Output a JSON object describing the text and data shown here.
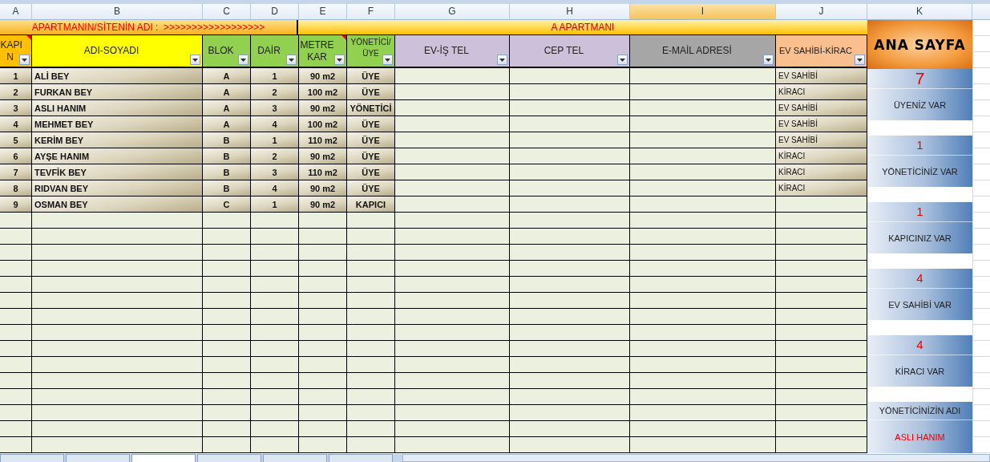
{
  "column_headers": [
    {
      "label": "A",
      "selected": false
    },
    {
      "label": "B",
      "selected": false
    },
    {
      "label": "C",
      "selected": false
    },
    {
      "label": "D",
      "selected": false
    },
    {
      "label": "E",
      "selected": false
    },
    {
      "label": "F",
      "selected": false
    },
    {
      "label": "G",
      "selected": false
    },
    {
      "label": "H",
      "selected": false
    },
    {
      "label": "I",
      "selected": true
    },
    {
      "label": "J",
      "selected": false
    },
    {
      "label": "K",
      "selected": false
    }
  ],
  "title_row": {
    "label": "APARTMANIN/SİTENİN ADI :  >>>>>>>>>>>>>>>>>>",
    "value": "A APARTMANI"
  },
  "table": {
    "columns": [
      {
        "label": "KAPI N",
        "color": "#ffc000",
        "comment": true
      },
      {
        "label": "ADI-SOYADI",
        "color": "#ffff00",
        "comment": false
      },
      {
        "label": "BLOK",
        "color": "#92d050",
        "comment": false
      },
      {
        "label": "DAİR",
        "color": "#92d050",
        "comment": false
      },
      {
        "label": "METRE KAR",
        "color": "#92d050",
        "comment": true
      },
      {
        "label": "YÖNETİCİ/ ÜYE",
        "color": "#92d050",
        "comment": false
      },
      {
        "label": "EV-İŞ TEL",
        "color": "#ccc0da",
        "comment": false
      },
      {
        "label": "CEP TEL",
        "color": "#ccc0da",
        "comment": false
      },
      {
        "label": "E-MAİL ADRESİ",
        "color": "#a6a6a6",
        "comment": false
      },
      {
        "label": "EV SAHİBİ-KİRAC",
        "color": "#fabf8f",
        "comment": false
      }
    ],
    "rows": [
      [
        "1",
        "ALİ BEY",
        "A",
        "1",
        "90 m2",
        "ÜYE",
        "",
        "",
        "",
        "EV SAHİBİ"
      ],
      [
        "2",
        "FURKAN BEY",
        "A",
        "2",
        "100 m2",
        "ÜYE",
        "",
        "",
        "",
        "KİRACI"
      ],
      [
        "3",
        "ASLI HANIM",
        "A",
        "3",
        "90 m2",
        "YÖNETİCİ",
        "",
        "",
        "",
        "EV SAHİBİ"
      ],
      [
        "4",
        "MEHMET BEY",
        "A",
        "4",
        "100 m2",
        "ÜYE",
        "",
        "",
        "",
        "EV SAHİBİ"
      ],
      [
        "5",
        "KERİM BEY",
        "B",
        "1",
        "110 m2",
        "ÜYE",
        "",
        "",
        "",
        "EV SAHİBİ"
      ],
      [
        "6",
        "AYŞE HANIM",
        "B",
        "2",
        "90 m2",
        "ÜYE",
        "",
        "",
        "",
        "KİRACI"
      ],
      [
        "7",
        "TEVFİK BEY",
        "B",
        "3",
        "110 m2",
        "ÜYE",
        "",
        "",
        "",
        "KİRACI"
      ],
      [
        "8",
        "RIDVAN BEY",
        "B",
        "4",
        "90 m2",
        "ÜYE",
        "",
        "",
        "",
        "KİRACI"
      ],
      [
        "9",
        "OSMAN BEY",
        "C",
        "1",
        "90 m2",
        "KAPICI",
        "",
        "",
        "",
        ""
      ]
    ]
  },
  "sheet_tabs": [
    {
      "selected": false
    },
    {
      "selected": false
    },
    {
      "selected": true
    },
    {
      "selected": false
    },
    {
      "selected": false
    },
    {
      "selected": false
    }
  ],
  "home_button": {
    "label": "ANA SAYFA"
  },
  "summary": [
    {
      "kind": "count",
      "value": "7",
      "label": "ÜYENİZ VAR"
    },
    {
      "kind": "count",
      "value": "1",
      "label": "YÖNETİCİNİZ VAR"
    },
    {
      "kind": "count",
      "value": "1",
      "label": "KAPICINIZ VAR"
    },
    {
      "kind": "count",
      "value": "4",
      "label": "EV SAHİBİ VAR"
    },
    {
      "kind": "count",
      "value": "4",
      "label": "KİRACI VAR"
    },
    {
      "kind": "name",
      "label": "YÖNETİCİNİZİN ADI",
      "value": "ASLI HANIM"
    }
  ]
}
